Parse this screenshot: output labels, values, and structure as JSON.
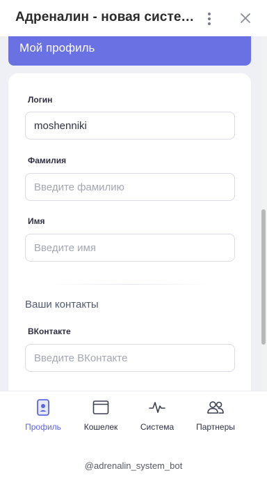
{
  "header": {
    "title": "Адреналин - новая систем..."
  },
  "page": {
    "banner_title": "Мой профиль"
  },
  "form": {
    "login": {
      "label": "Логин",
      "value": "moshenniki"
    },
    "surname": {
      "label": "Фамилия",
      "placeholder": "Введите фамилию"
    },
    "name": {
      "label": "Имя",
      "placeholder": "Введите имя"
    },
    "contacts_title": "Ваши контакты",
    "vk": {
      "label": "ВКонтакте",
      "placeholder": "Введите ВКонтакте"
    }
  },
  "nav": {
    "items": [
      {
        "label": "Профиль",
        "icon": "profile-icon",
        "active": true
      },
      {
        "label": "Кошелек",
        "icon": "wallet-icon",
        "active": false
      },
      {
        "label": "Система",
        "icon": "activity-icon",
        "active": false
      },
      {
        "label": "Партнеры",
        "icon": "partners-icon",
        "active": false
      }
    ]
  },
  "footer": {
    "bot_handle": "@adrenalin_system_bot"
  },
  "colors": {
    "accent": "#6a72e3",
    "active_nav": "#5f67e0",
    "page_bg": "#eef0f5"
  }
}
